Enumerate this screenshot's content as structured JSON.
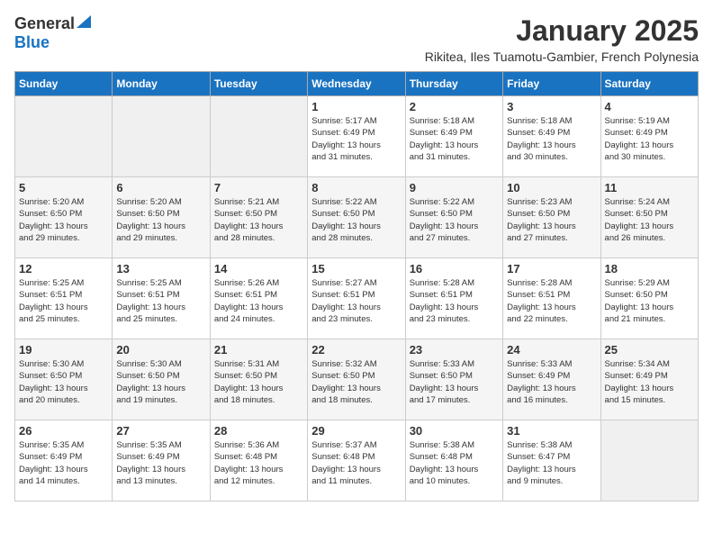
{
  "header": {
    "logo_general": "General",
    "logo_blue": "Blue",
    "title": "January 2025",
    "subtitle": "Rikitea, Iles Tuamotu-Gambier, French Polynesia"
  },
  "weekdays": [
    "Sunday",
    "Monday",
    "Tuesday",
    "Wednesday",
    "Thursday",
    "Friday",
    "Saturday"
  ],
  "weeks": [
    [
      {
        "day": "",
        "info": ""
      },
      {
        "day": "",
        "info": ""
      },
      {
        "day": "",
        "info": ""
      },
      {
        "day": "1",
        "info": "Sunrise: 5:17 AM\nSunset: 6:49 PM\nDaylight: 13 hours\nand 31 minutes."
      },
      {
        "day": "2",
        "info": "Sunrise: 5:18 AM\nSunset: 6:49 PM\nDaylight: 13 hours\nand 31 minutes."
      },
      {
        "day": "3",
        "info": "Sunrise: 5:18 AM\nSunset: 6:49 PM\nDaylight: 13 hours\nand 30 minutes."
      },
      {
        "day": "4",
        "info": "Sunrise: 5:19 AM\nSunset: 6:49 PM\nDaylight: 13 hours\nand 30 minutes."
      }
    ],
    [
      {
        "day": "5",
        "info": "Sunrise: 5:20 AM\nSunset: 6:50 PM\nDaylight: 13 hours\nand 29 minutes."
      },
      {
        "day": "6",
        "info": "Sunrise: 5:20 AM\nSunset: 6:50 PM\nDaylight: 13 hours\nand 29 minutes."
      },
      {
        "day": "7",
        "info": "Sunrise: 5:21 AM\nSunset: 6:50 PM\nDaylight: 13 hours\nand 28 minutes."
      },
      {
        "day": "8",
        "info": "Sunrise: 5:22 AM\nSunset: 6:50 PM\nDaylight: 13 hours\nand 28 minutes."
      },
      {
        "day": "9",
        "info": "Sunrise: 5:22 AM\nSunset: 6:50 PM\nDaylight: 13 hours\nand 27 minutes."
      },
      {
        "day": "10",
        "info": "Sunrise: 5:23 AM\nSunset: 6:50 PM\nDaylight: 13 hours\nand 27 minutes."
      },
      {
        "day": "11",
        "info": "Sunrise: 5:24 AM\nSunset: 6:50 PM\nDaylight: 13 hours\nand 26 minutes."
      }
    ],
    [
      {
        "day": "12",
        "info": "Sunrise: 5:25 AM\nSunset: 6:51 PM\nDaylight: 13 hours\nand 25 minutes."
      },
      {
        "day": "13",
        "info": "Sunrise: 5:25 AM\nSunset: 6:51 PM\nDaylight: 13 hours\nand 25 minutes."
      },
      {
        "day": "14",
        "info": "Sunrise: 5:26 AM\nSunset: 6:51 PM\nDaylight: 13 hours\nand 24 minutes."
      },
      {
        "day": "15",
        "info": "Sunrise: 5:27 AM\nSunset: 6:51 PM\nDaylight: 13 hours\nand 23 minutes."
      },
      {
        "day": "16",
        "info": "Sunrise: 5:28 AM\nSunset: 6:51 PM\nDaylight: 13 hours\nand 23 minutes."
      },
      {
        "day": "17",
        "info": "Sunrise: 5:28 AM\nSunset: 6:51 PM\nDaylight: 13 hours\nand 22 minutes."
      },
      {
        "day": "18",
        "info": "Sunrise: 5:29 AM\nSunset: 6:50 PM\nDaylight: 13 hours\nand 21 minutes."
      }
    ],
    [
      {
        "day": "19",
        "info": "Sunrise: 5:30 AM\nSunset: 6:50 PM\nDaylight: 13 hours\nand 20 minutes."
      },
      {
        "day": "20",
        "info": "Sunrise: 5:30 AM\nSunset: 6:50 PM\nDaylight: 13 hours\nand 19 minutes."
      },
      {
        "day": "21",
        "info": "Sunrise: 5:31 AM\nSunset: 6:50 PM\nDaylight: 13 hours\nand 18 minutes."
      },
      {
        "day": "22",
        "info": "Sunrise: 5:32 AM\nSunset: 6:50 PM\nDaylight: 13 hours\nand 18 minutes."
      },
      {
        "day": "23",
        "info": "Sunrise: 5:33 AM\nSunset: 6:50 PM\nDaylight: 13 hours\nand 17 minutes."
      },
      {
        "day": "24",
        "info": "Sunrise: 5:33 AM\nSunset: 6:49 PM\nDaylight: 13 hours\nand 16 minutes."
      },
      {
        "day": "25",
        "info": "Sunrise: 5:34 AM\nSunset: 6:49 PM\nDaylight: 13 hours\nand 15 minutes."
      }
    ],
    [
      {
        "day": "26",
        "info": "Sunrise: 5:35 AM\nSunset: 6:49 PM\nDaylight: 13 hours\nand 14 minutes."
      },
      {
        "day": "27",
        "info": "Sunrise: 5:35 AM\nSunset: 6:49 PM\nDaylight: 13 hours\nand 13 minutes."
      },
      {
        "day": "28",
        "info": "Sunrise: 5:36 AM\nSunset: 6:48 PM\nDaylight: 13 hours\nand 12 minutes."
      },
      {
        "day": "29",
        "info": "Sunrise: 5:37 AM\nSunset: 6:48 PM\nDaylight: 13 hours\nand 11 minutes."
      },
      {
        "day": "30",
        "info": "Sunrise: 5:38 AM\nSunset: 6:48 PM\nDaylight: 13 hours\nand 10 minutes."
      },
      {
        "day": "31",
        "info": "Sunrise: 5:38 AM\nSunset: 6:47 PM\nDaylight: 13 hours\nand 9 minutes."
      },
      {
        "day": "",
        "info": ""
      }
    ]
  ]
}
